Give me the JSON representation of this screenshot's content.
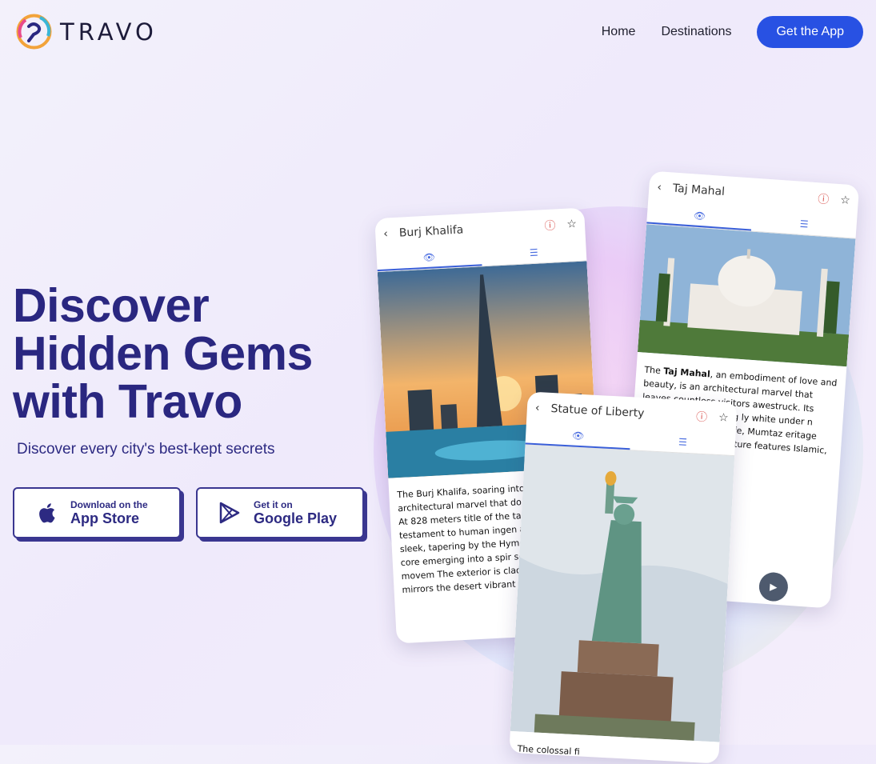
{
  "brand": {
    "name": "TRAVO"
  },
  "nav": {
    "home": "Home",
    "destinations": "Destinations",
    "cta": "Get the App"
  },
  "hero": {
    "line1": "Discover",
    "line2": "Hidden Gems",
    "line3": "with Travo",
    "subtitle": "Discover every city's best-kept secrets"
  },
  "appstore": {
    "small": "Download on the",
    "big": "App Store"
  },
  "googleplay": {
    "small": "Get it on",
    "big": "Google Play"
  },
  "phones": {
    "burj": {
      "title": "Burj Khalifa",
      "text": "The Burj Khalifa, soaring into the architectural marvel that do Dubai skyline. At 828 meters title of the tallest building in testament to human ingen ambition. Its sleek, tapering by the Hymenocallis flowe core emerging into a spir sense of upward movem The exterior is clad in refl which mirrors the desert vibrant city below. creat"
    },
    "taj": {
      "title": "Taj Mahal",
      "text_bold": "Taj Mahal",
      "text_pre": "The ",
      "text": ", an embodiment of love and beauty, is an architectural marvel that leaves countless visitors awestruck. Its reflects the appearing ly white under n under ah Jahan as a ife, Mumtaz eritage site 0,000 workers ecture features Islamic, s definitiv er towers,"
    },
    "liberty": {
      "title": "Statue of Liberty",
      "text": "The colossal fi"
    }
  },
  "colors": {
    "accent": "#2851e3",
    "heading": "#2a2780"
  }
}
